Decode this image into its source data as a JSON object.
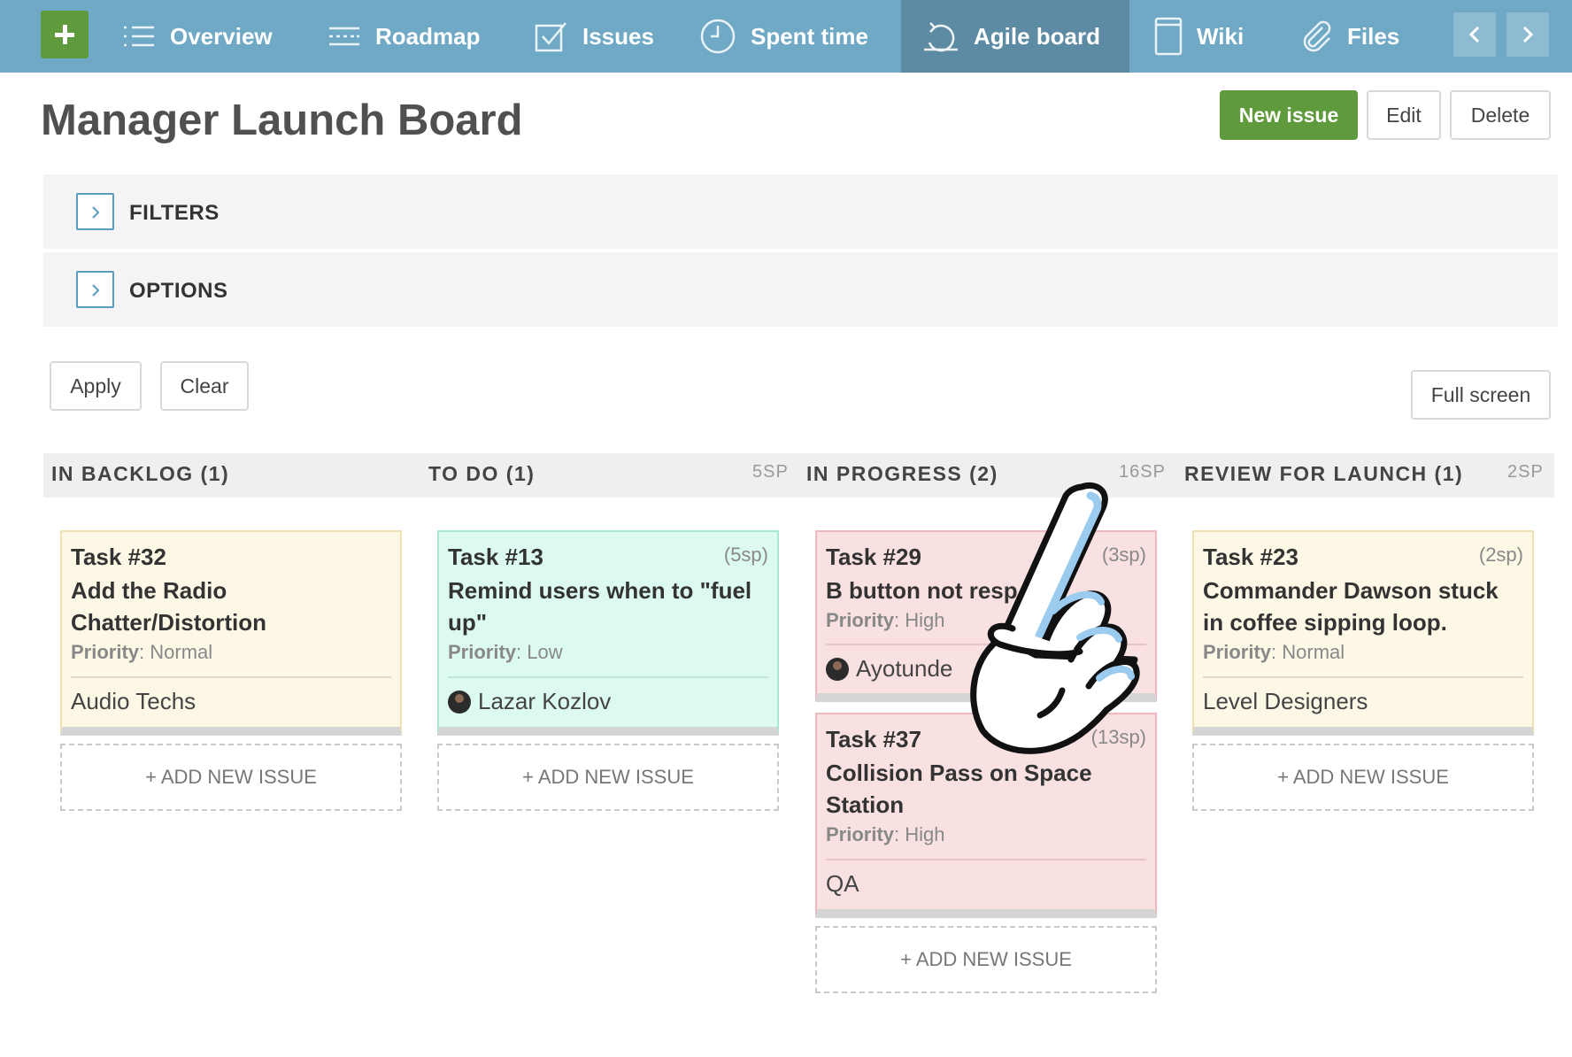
{
  "nav": {
    "items": [
      {
        "label": "Overview",
        "icon": "list-icon"
      },
      {
        "label": "Roadmap",
        "icon": "roadmap-icon"
      },
      {
        "label": "Issues",
        "icon": "checkbox-icon"
      },
      {
        "label": "Spent time",
        "icon": "clock-icon"
      },
      {
        "label": "Agile board",
        "icon": "agile-cycle-icon",
        "active": true
      },
      {
        "label": "Wiki",
        "icon": "document-icon"
      },
      {
        "label": "Files",
        "icon": "paperclip-icon"
      }
    ],
    "accent_color": "#6fa9c5",
    "active_color": "#5c8ba3"
  },
  "header": {
    "title": "Manager Launch Board",
    "new_issue": "New issue",
    "edit": "Edit",
    "delete": "Delete"
  },
  "panels": {
    "filters": "FILTERS",
    "options": "OPTIONS"
  },
  "actions": {
    "apply": "Apply",
    "clear": "Clear",
    "full_screen": "Full screen"
  },
  "columns": [
    {
      "title": "IN BACKLOG (1)",
      "sp": "",
      "add_label": "+ ADD NEW ISSUE",
      "cards": [
        {
          "id": "Task #32",
          "sp": "",
          "subject": "Add the Radio Chatter/Distortion",
          "priority_label": "Priority",
          "priority": "Normal",
          "assignee": "Audio Techs",
          "color": "yellow"
        }
      ]
    },
    {
      "title": "TO DO (1)",
      "sp": "5SP",
      "add_label": "+ ADD NEW ISSUE",
      "cards": [
        {
          "id": "Task #13",
          "sp": "(5sp)",
          "subject": "Remind users when to \"fuel up\"",
          "priority_label": "Priority",
          "priority": "Low",
          "assignee": "Lazar Kozlov",
          "color": "green"
        }
      ]
    },
    {
      "title": "IN PROGRESS (2)",
      "sp": "16SP",
      "add_label": "+ ADD NEW ISSUE",
      "cards": [
        {
          "id": "Task #29",
          "sp": "(3sp)",
          "subject": "B button not resp",
          "priority_label": "Priority",
          "priority": "High",
          "assignee": "Ayotunde",
          "color": "red"
        },
        {
          "id": "Task #37",
          "sp": "(13sp)",
          "subject": "Collision Pass on Space Station",
          "priority_label": "Priority",
          "priority": "High",
          "assignee": "QA",
          "color": "red"
        }
      ]
    },
    {
      "title": "REVIEW FOR LAUNCH (1)",
      "sp": "2SP",
      "add_label": "+ ADD NEW ISSUE",
      "cards": [
        {
          "id": "Task #23",
          "sp": "(2sp)",
          "subject": "Commander Dawson stuck in coffee sipping loop.",
          "priority_label": "Priority",
          "priority": "Normal",
          "assignee": "Level Designers",
          "color": "yellow"
        }
      ]
    }
  ]
}
